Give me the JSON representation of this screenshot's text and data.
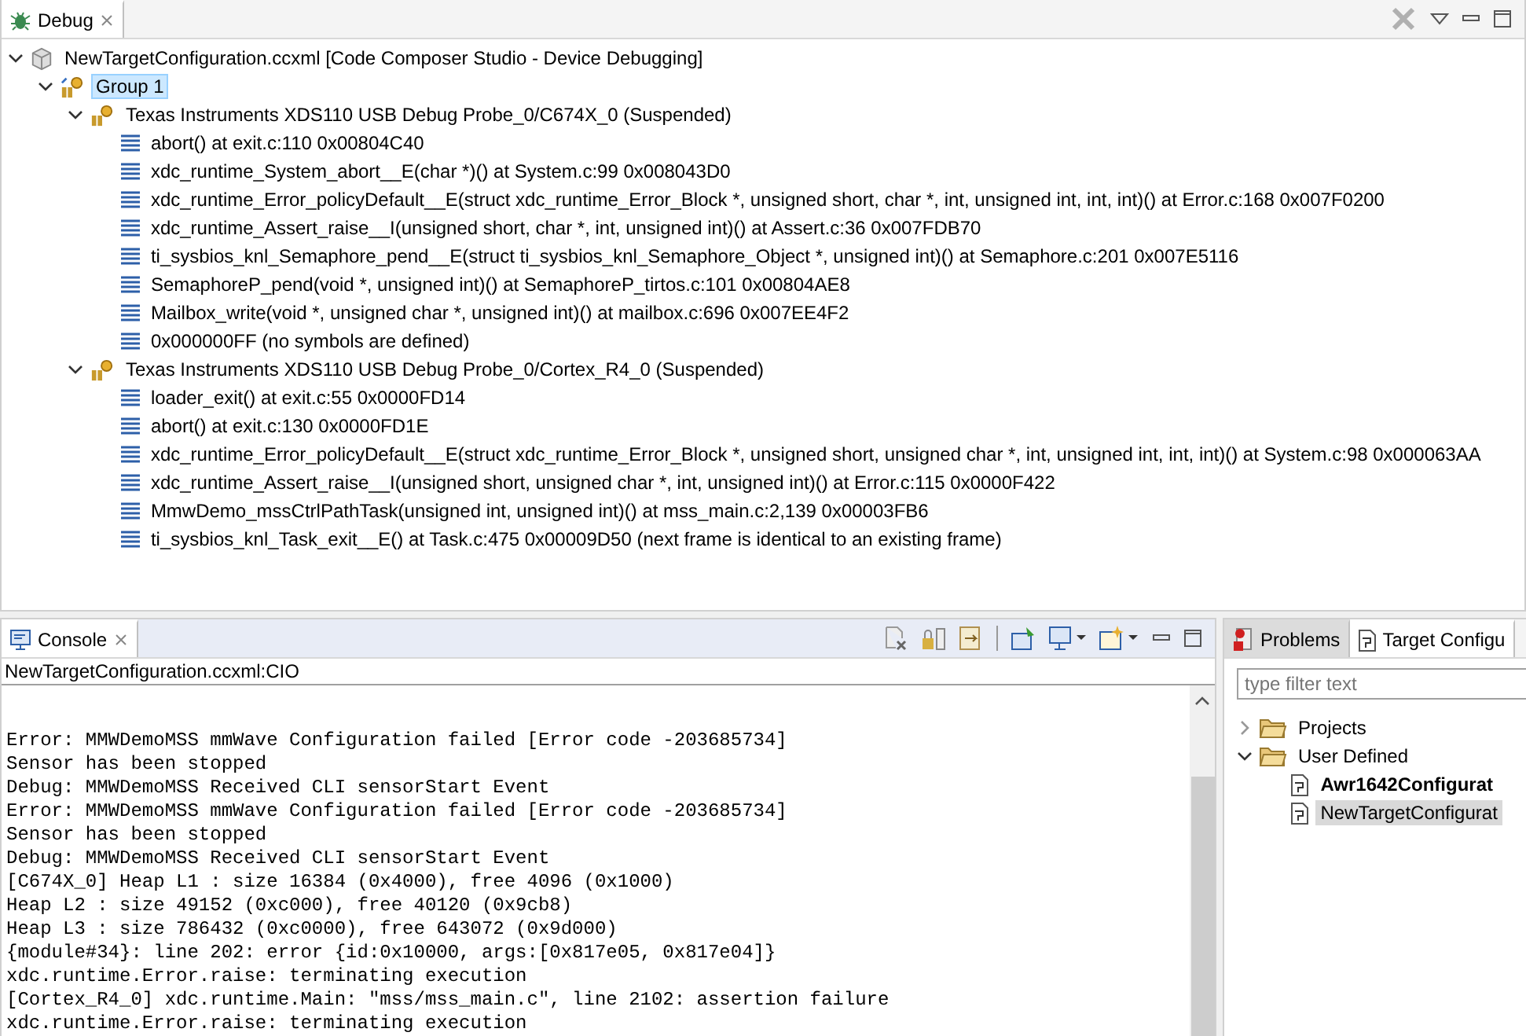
{
  "debug": {
    "tab": {
      "label": "Debug",
      "selected": true
    },
    "tree": [
      {
        "kind": "launch",
        "label": "NewTargetConfiguration.ccxml [Code Composer Studio - Device Debugging]",
        "expanded": true,
        "selected": false,
        "children": [
          {
            "kind": "group",
            "label": "Group 1",
            "expanded": true,
            "selected": true,
            "children": [
              {
                "kind": "thread",
                "label": "Texas Instruments XDS110 USB Debug Probe_0/C674X_0 (Suspended)",
                "expanded": true,
                "selected": false,
                "children": [
                  {
                    "kind": "frame",
                    "label": "abort() at exit.c:110 0x00804C40",
                    "selected": false
                  },
                  {
                    "kind": "frame",
                    "label": "xdc_runtime_System_abort__E(char *)() at System.c:99 0x008043D0",
                    "selected": false
                  },
                  {
                    "kind": "frame",
                    "label": "xdc_runtime_Error_policyDefault__E(struct xdc_runtime_Error_Block *, unsigned short, char *, int, unsigned int, int, int)() at Error.c:168 0x007F0200",
                    "selected": false
                  },
                  {
                    "kind": "frame",
                    "label": "xdc_runtime_Assert_raise__I(unsigned short, char *, int, unsigned int)() at Assert.c:36 0x007FDB70",
                    "selected": false
                  },
                  {
                    "kind": "frame",
                    "label": "ti_sysbios_knl_Semaphore_pend__E(struct ti_sysbios_knl_Semaphore_Object *, unsigned int)() at Semaphore.c:201 0x007E5116",
                    "selected": false
                  },
                  {
                    "kind": "frame",
                    "label": "SemaphoreP_pend(void *, unsigned int)() at SemaphoreP_tirtos.c:101 0x00804AE8",
                    "selected": false
                  },
                  {
                    "kind": "frame",
                    "label": "Mailbox_write(void *, unsigned char *, unsigned int)() at mailbox.c:696 0x007EE4F2",
                    "selected": false
                  },
                  {
                    "kind": "frame",
                    "label": "0x000000FF  (no symbols are defined)",
                    "selected": false
                  }
                ]
              },
              {
                "kind": "thread",
                "label": "Texas Instruments XDS110 USB Debug Probe_0/Cortex_R4_0 (Suspended)",
                "expanded": true,
                "selected": false,
                "children": [
                  {
                    "kind": "frame",
                    "label": "loader_exit() at exit.c:55 0x0000FD14",
                    "selected": false
                  },
                  {
                    "kind": "frame",
                    "label": "abort() at exit.c:130 0x0000FD1E",
                    "selected": false
                  },
                  {
                    "kind": "frame",
                    "label": "xdc_runtime_Error_policyDefault__E(struct xdc_runtime_Error_Block *, unsigned short, unsigned char *, int, unsigned int, int, int)() at System.c:98 0x000063AA",
                    "selected": false
                  },
                  {
                    "kind": "frame",
                    "label": "xdc_runtime_Assert_raise__I(unsigned short, unsigned char *, int, unsigned int)() at Error.c:115 0x0000F422",
                    "selected": false
                  },
                  {
                    "kind": "frame",
                    "label": "MmwDemo_mssCtrlPathTask(unsigned int, unsigned int)() at mss_main.c:2,139 0x00003FB6",
                    "selected": false
                  },
                  {
                    "kind": "frame",
                    "label": "ti_sysbios_knl_Task_exit__E() at Task.c:475 0x00009D50  (next frame is identical to an existing frame)",
                    "selected": false
                  }
                ]
              }
            ]
          }
        ]
      }
    ]
  },
  "console": {
    "tab": {
      "label": "Console",
      "selected": true
    },
    "subtitle": "NewTargetConfiguration.ccxml:CIO",
    "lines": [
      "Error: MMWDemoMSS mmWave Configuration failed [Error code -203685734]",
      "Sensor has been stopped",
      "Debug: MMWDemoMSS Received CLI sensorStart Event",
      "Error: MMWDemoMSS mmWave Configuration failed [Error code -203685734]",
      "Sensor has been stopped",
      "Debug: MMWDemoMSS Received CLI sensorStart Event",
      "[C674X_0] Heap L1 : size 16384 (0x4000), free 4096 (0x1000)",
      "Heap L2 : size 49152 (0xc000), free 40120 (0x9cb8)",
      "Heap L3 : size 786432 (0xc0000), free 643072 (0x9d000)",
      "{module#34}: line 202: error {id:0x10000, args:[0x817e05, 0x817e04]}",
      "xdc.runtime.Error.raise: terminating execution",
      "[Cortex_R4_0] xdc.runtime.Main: \"mss/mss_main.c\", line 2102: assertion failure",
      "xdc.runtime.Error.raise: terminating execution"
    ]
  },
  "targets": {
    "tabs": [
      {
        "label": "Problems",
        "selected": false
      },
      {
        "label": "Target Configu",
        "selected": true
      }
    ],
    "filter": {
      "placeholder": "type filter text"
    },
    "tree": [
      {
        "label": "Projects",
        "expanded": false,
        "selected": false,
        "bold": false
      },
      {
        "label": "User Defined",
        "expanded": true,
        "selected": false,
        "bold": false,
        "children": [
          {
            "label": "Awr1642Configurat",
            "selected": false,
            "bold": true
          },
          {
            "label": "NewTargetConfigurat",
            "selected": true,
            "bold": false
          }
        ]
      }
    ]
  }
}
